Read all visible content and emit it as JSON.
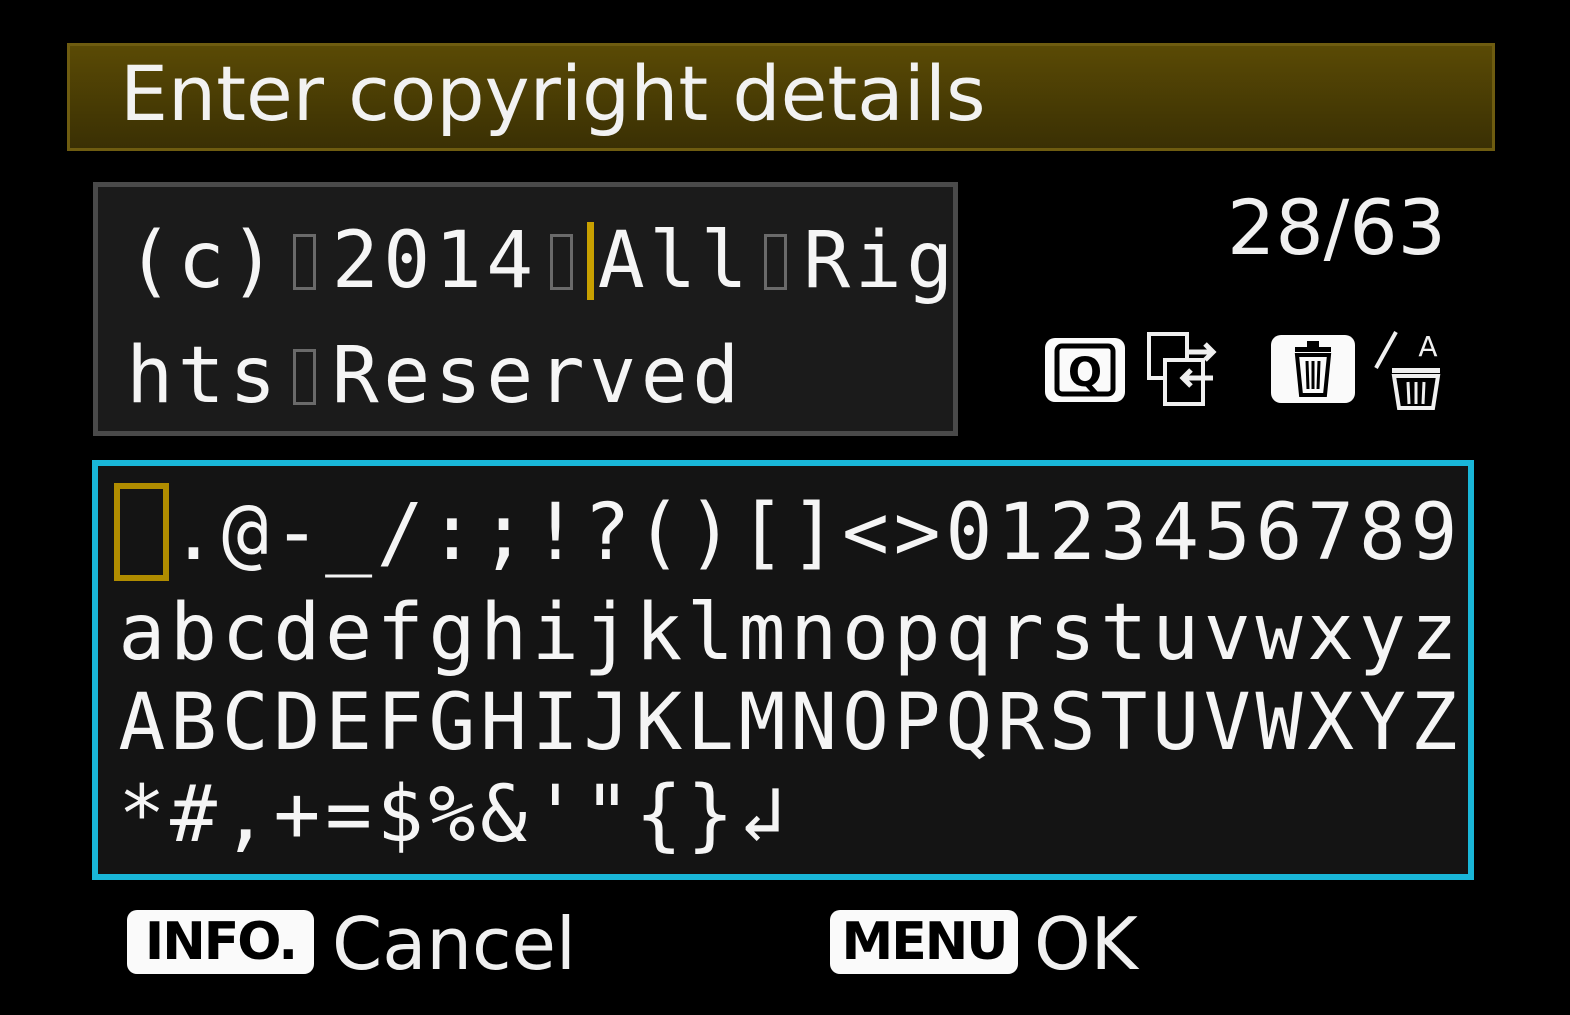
{
  "title": "Enter copyright details",
  "counter": "28/63",
  "text_line1": [
    "(",
    "c",
    ")",
    " ",
    "2",
    "0",
    "1",
    "4",
    " ",
    "|",
    "A",
    "l",
    "l",
    " ",
    "R",
    "i",
    "g"
  ],
  "text_line2": [
    "h",
    "t",
    "s",
    " ",
    "R",
    "e",
    "s",
    "e",
    "r",
    "v",
    "e",
    "d"
  ],
  "keyboard": {
    "row1": [
      " ",
      ".",
      "@",
      "-",
      "_",
      "/",
      ":",
      ";",
      "!",
      "?",
      "(",
      ")",
      "[",
      "]",
      "<",
      ">",
      "0",
      "1",
      "2",
      "3",
      "4",
      "5",
      "6",
      "7",
      "8",
      "9"
    ],
    "row2": [
      "a",
      "b",
      "c",
      "d",
      "e",
      "f",
      "g",
      "h",
      "i",
      "j",
      "k",
      "l",
      "m",
      "n",
      "o",
      "p",
      "q",
      "r",
      "s",
      "t",
      "u",
      "v",
      "w",
      "x",
      "y",
      "z"
    ],
    "row3": [
      "A",
      "B",
      "C",
      "D",
      "E",
      "F",
      "G",
      "H",
      "I",
      "J",
      "K",
      "L",
      "M",
      "N",
      "O",
      "P",
      "Q",
      "R",
      "S",
      "T",
      "U",
      "V",
      "W",
      "X",
      "Y",
      "Z"
    ],
    "row4": [
      "*",
      "#",
      ",",
      "+",
      "=",
      "$",
      "%",
      "&",
      "'",
      "\"",
      "{",
      "}",
      "↲"
    ]
  },
  "footer": {
    "info_button": "INFO.",
    "cancel_label": "Cancel",
    "menu_button": "MENU",
    "ok_label": "OK"
  },
  "icons": [
    "q-button-icon",
    "switch-area-icon",
    "delete-icon",
    "delete-all-icon"
  ],
  "colors": {
    "keyboard_border": "#19b6d8",
    "cursor": "#c8a000",
    "title_bg": "#4a3d05"
  }
}
